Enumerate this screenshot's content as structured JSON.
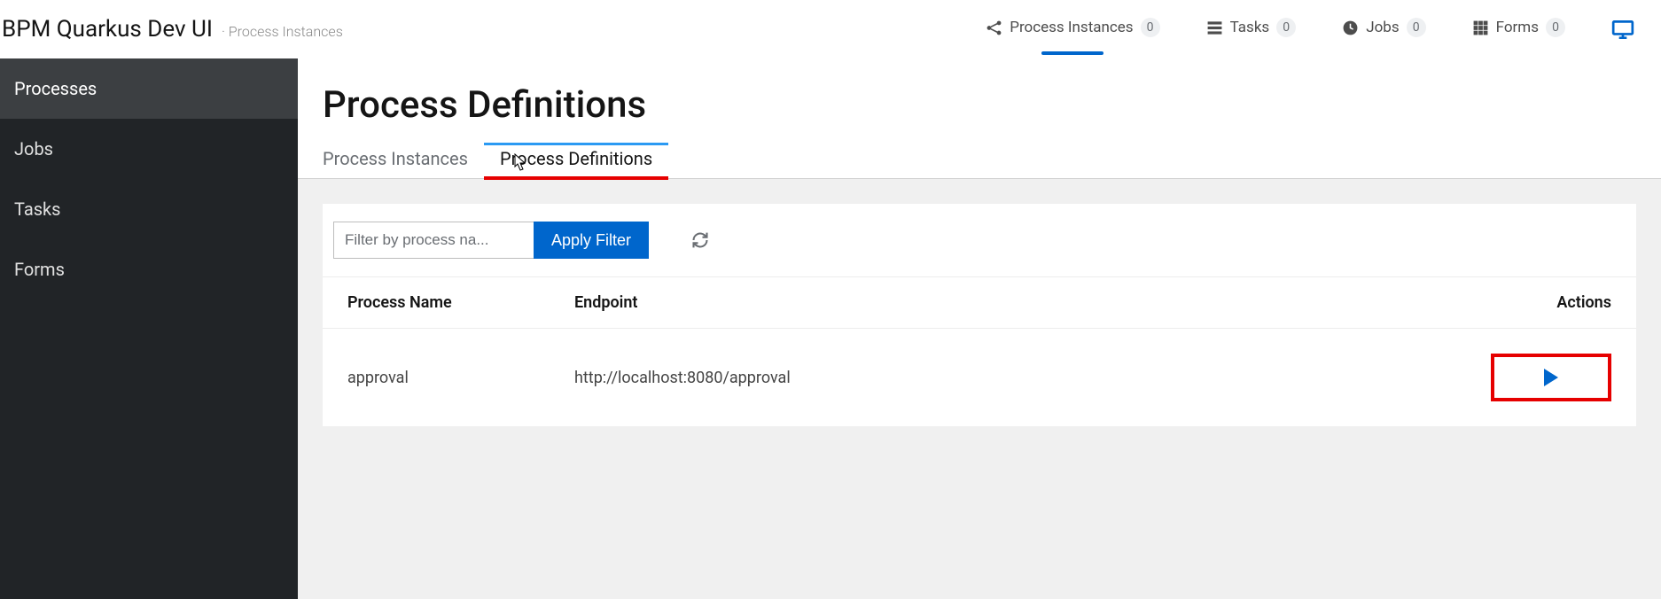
{
  "header": {
    "brand": "BPM Quarkus Dev UI",
    "section": "Process Instances",
    "nav": [
      {
        "label": "Process Instances",
        "count": "0",
        "icon": "share"
      },
      {
        "label": "Tasks",
        "count": "0",
        "icon": "tasks"
      },
      {
        "label": "Jobs",
        "count": "0",
        "icon": "clock"
      },
      {
        "label": "Forms",
        "count": "0",
        "icon": "grid"
      }
    ]
  },
  "sidebar": {
    "items": [
      "Processes",
      "Jobs",
      "Tasks",
      "Forms"
    ],
    "active_index": 0
  },
  "page": {
    "title": "Process Definitions",
    "tabs": [
      "Process Instances",
      "Process Definitions"
    ],
    "active_tab_index": 1,
    "filter": {
      "placeholder": "Filter by process na...",
      "apply_label": "Apply Filter"
    },
    "table": {
      "columns": [
        "Process Name",
        "Endpoint",
        "Actions"
      ],
      "rows": [
        {
          "name": "approval",
          "endpoint": "http://localhost:8080/approval"
        }
      ]
    }
  }
}
